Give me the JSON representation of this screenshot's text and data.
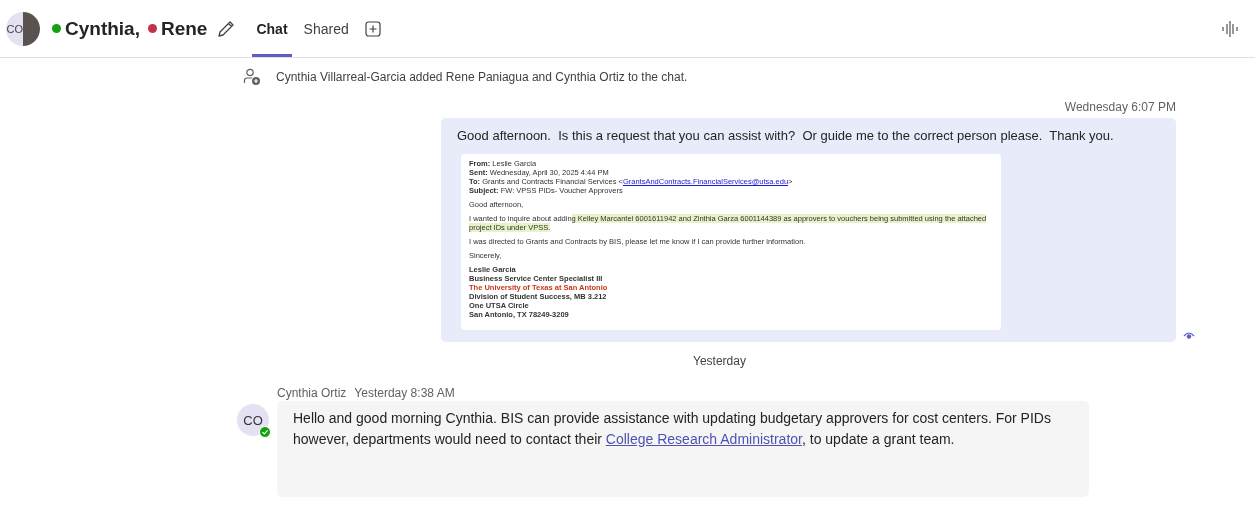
{
  "header": {
    "avatar_initials": "CO",
    "participants": [
      {
        "name": "Cynthia",
        "separator": ",",
        "color": "#13a10e"
      },
      {
        "name": "Rene",
        "color": "#c4314b"
      }
    ],
    "tabs": [
      {
        "label": "Chat",
        "selected": true
      },
      {
        "label": "Shared",
        "selected": false
      }
    ]
  },
  "messages": [
    {
      "kind": "system",
      "text": "Cynthia Villarreal-Garcia added Rene Paniagua and Cynthia Ortiz to the chat."
    },
    {
      "kind": "outgoing",
      "time": "Wednesday 6:07 PM",
      "text": "Good afternoon.  Is this a request that you can assist with?  Or guide me to the correct person please.  Thank you.",
      "seen": true,
      "attachment": {
        "fields": [
          {
            "label": "From:",
            "value": "Leslie Garcia"
          },
          {
            "label": "Sent:",
            "value": "Wednesday, April 30, 2025 4:44 PM"
          },
          {
            "label": "To:",
            "value": "Grants and Contracts Financial Services <",
            "link": "GrantsAndContracts.FinancialServices@utsa.edu",
            "after": ">"
          },
          {
            "label": "Subject:",
            "value": "FW: VPSS PIDs- Voucher Approvers"
          }
        ],
        "paragraphs": [
          [
            {
              "text": "Good afternoon,",
              "highlight": false
            }
          ],
          [
            {
              "text": "I wanted to inquire about addin",
              "highlight": false
            },
            {
              "text": "g Kelley Marcantel 6001611942 and Zinthia Garza 6001144389 as approvers to vouchers being submitted using the attached project IDs under VPSS.",
              "highlight": true
            }
          ],
          [
            {
              "text": "I was directed to Grants and Contracts by BIS, please let me know if I can provide further information.",
              "highlight": false
            }
          ],
          [
            {
              "text": "Sincerely,",
              "highlight": false
            }
          ]
        ],
        "signature": [
          {
            "text": "Leslie Garcia",
            "accent": false
          },
          {
            "text": "Business Service Center Specialist III",
            "accent": false
          },
          {
            "text": "The University of Texas at San Antonio",
            "accent": true
          },
          {
            "text": "Division of Student Success, MB 3.212",
            "accent": false
          },
          {
            "text": "One UTSA Circle",
            "accent": false
          },
          {
            "text": "San Antonio, TX 78249-3209",
            "accent": false
          }
        ]
      }
    },
    {
      "kind": "divider",
      "text": "Yesterday"
    },
    {
      "kind": "incoming",
      "author": "Cynthia Ortiz",
      "time": "Yesterday 8:38 AM",
      "avatar_initials": "CO",
      "color": "#13a10e",
      "text": "Hello and good morning Cynthia. BIS can provide assistance with updating budgetary approvers for cost centers. For PIDs however, departments would need to contact their ",
      "link": "College Research Administrator",
      "text_after": ", to update a grant team."
    }
  ]
}
